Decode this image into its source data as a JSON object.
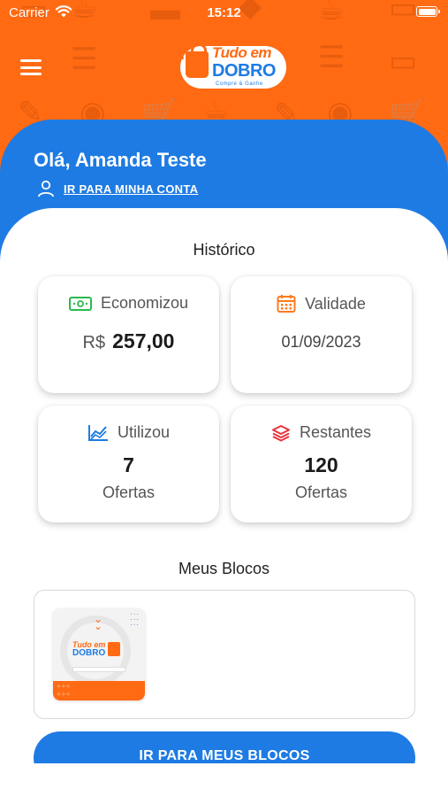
{
  "status_bar": {
    "carrier": "Carrier",
    "time": "15:12"
  },
  "header": {
    "logo": {
      "line1": "Tudo em",
      "line2": "DOBRO",
      "line3": "Compre & Ganhe"
    },
    "greeting": "Olá, Amanda Teste",
    "account_link": "IR PARA MINHA CONTA"
  },
  "historico": {
    "title": "Histórico",
    "economizou": {
      "label": "Economizou",
      "currency": "R$",
      "value": "257,00"
    },
    "validade": {
      "label": "Validade",
      "value": "01/09/2023"
    },
    "utilizou": {
      "label": "Utilizou",
      "value": "7",
      "unit": "Ofertas"
    },
    "restantes": {
      "label": "Restantes",
      "value": "120",
      "unit": "Ofertas"
    }
  },
  "blocos": {
    "title": "Meus Blocos",
    "items": [
      {
        "logo_line1": "Tudo em",
        "logo_line2": "DOBRO"
      }
    ],
    "button_label": "IR PARA MEUS BLOCOS"
  },
  "colors": {
    "orange": "#ff6a13",
    "blue": "#1e7be3",
    "green": "#2db84d"
  }
}
